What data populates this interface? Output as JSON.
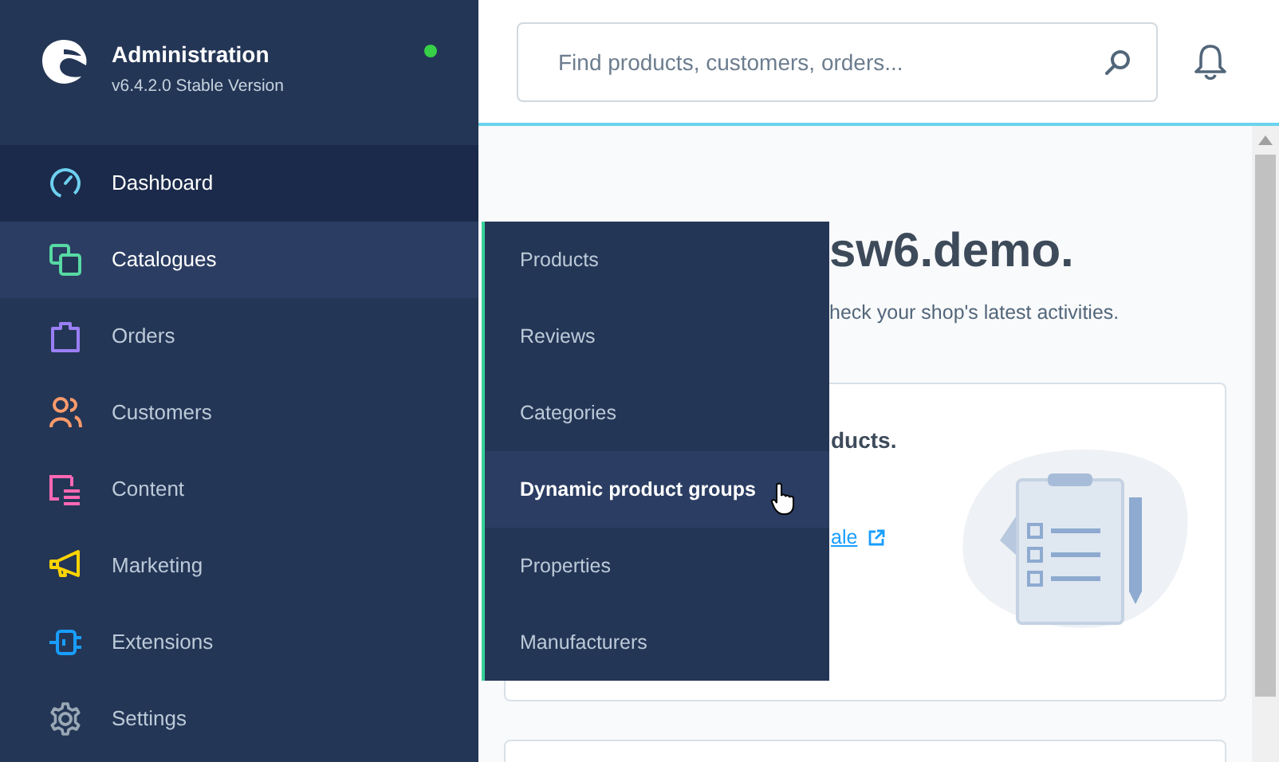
{
  "brand": {
    "title": "Administration",
    "version": "v6.4.2.0 Stable Version"
  },
  "menu": [
    {
      "label": "Dashboard",
      "kind": "dashboard",
      "color": "#6ed0f0",
      "selected": true,
      "expanded": false
    },
    {
      "label": "Catalogues",
      "kind": "catalogues",
      "color": "#57d9a3",
      "selected": false,
      "expanded": true
    },
    {
      "label": "Orders",
      "kind": "orders",
      "color": "#9a7ff5",
      "selected": false,
      "expanded": false
    },
    {
      "label": "Customers",
      "kind": "customers",
      "color": "#ff9b6b",
      "selected": false,
      "expanded": false
    },
    {
      "label": "Content",
      "kind": "content",
      "color": "#ff68b4",
      "selected": false,
      "expanded": false
    },
    {
      "label": "Marketing",
      "kind": "marketing",
      "color": "#ffd400",
      "selected": false,
      "expanded": false
    },
    {
      "label": "Extensions",
      "kind": "extensions",
      "color": "#189eff",
      "selected": false,
      "expanded": false
    },
    {
      "label": "Settings",
      "kind": "settings",
      "color": "#9aa8b5",
      "selected": false,
      "expanded": false
    }
  ],
  "submenu": [
    {
      "label": "Products",
      "selected": false
    },
    {
      "label": "Reviews",
      "selected": false
    },
    {
      "label": "Categories",
      "selected": false
    },
    {
      "label": "Dynamic product groups",
      "selected": true
    },
    {
      "label": "Properties",
      "selected": false
    },
    {
      "label": "Manufacturers",
      "selected": false
    }
  ],
  "search": {
    "placeholder": "Find products, customers, orders..."
  },
  "greeting": {
    "title": "sw6.demo.",
    "subtitle": "heck your shop's latest activities."
  },
  "card": {
    "title": "ducts.",
    "link": "ale"
  }
}
